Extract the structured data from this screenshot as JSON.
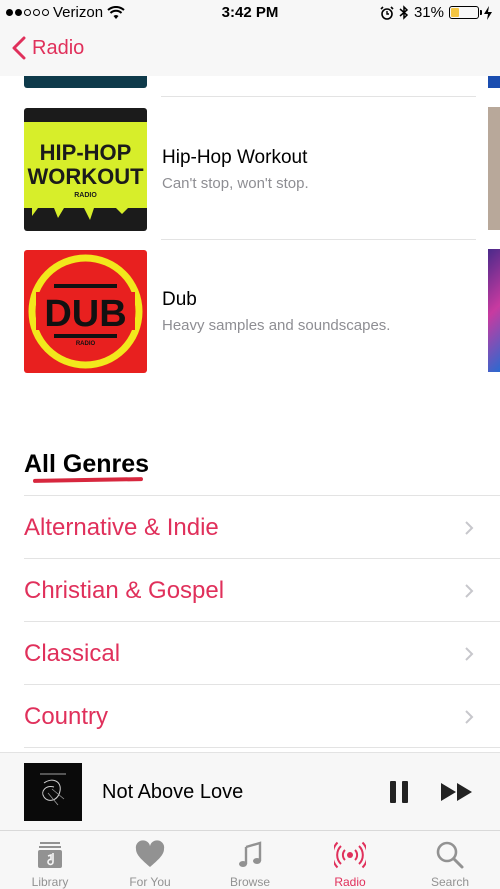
{
  "status_bar": {
    "carrier": "Verizon",
    "time": "3:42 PM",
    "battery": "31%",
    "battery_level": 0.31
  },
  "nav": {
    "back_label": "Radio"
  },
  "stations": [
    {
      "title": "Hip-Hop Workout",
      "subtitle": "Can't stop, won't stop.",
      "art_line1": "HIP-HOP",
      "art_line2": "WORKOUT",
      "art_caption": "RADIO"
    },
    {
      "title": "Dub",
      "subtitle": "Heavy samples and soundscapes.",
      "art_text": "DUB",
      "art_caption": "RADIO"
    }
  ],
  "genres": {
    "title": "All Genres",
    "items": [
      {
        "label": "Alternative & Indie"
      },
      {
        "label": "Christian & Gospel"
      },
      {
        "label": "Classical"
      },
      {
        "label": "Country"
      }
    ]
  },
  "mini_player": {
    "track_title": "Not Above Love"
  },
  "tabs": [
    {
      "label": "Library",
      "icon": "library-icon"
    },
    {
      "label": "For You",
      "icon": "heart-icon"
    },
    {
      "label": "Browse",
      "icon": "music-note-icon"
    },
    {
      "label": "Radio",
      "icon": "radio-icon",
      "active": true
    },
    {
      "label": "Search",
      "icon": "search-icon"
    }
  ],
  "colors": {
    "accent": "#e0305b",
    "secondary_text": "#8e8e93",
    "tab_inactive": "#929292"
  }
}
